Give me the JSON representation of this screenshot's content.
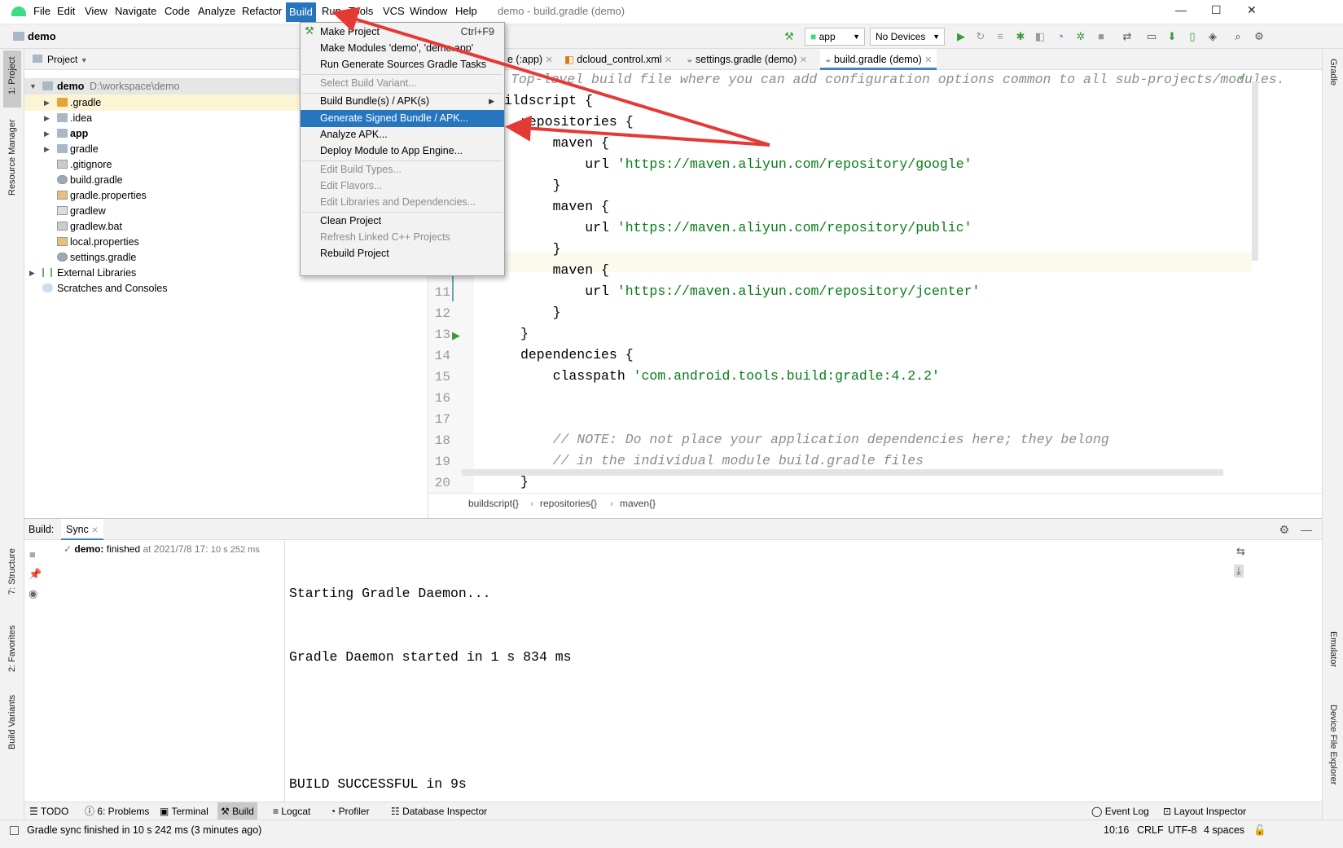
{
  "window": {
    "title": "demo - build.gradle (demo)"
  },
  "menubar": [
    "File",
    "Edit",
    "View",
    "Navigate",
    "Code",
    "Analyze",
    "Refactor",
    "Build",
    "Run",
    "Tools",
    "VCS",
    "Window",
    "Help"
  ],
  "navbar": {
    "project": "demo",
    "run_config": "app",
    "device": "No Devices"
  },
  "project_panel": {
    "view_label": "Project",
    "root": {
      "name": "demo",
      "path": "D:\\workspace\\demo"
    },
    "items": [
      ".gradle",
      ".idea",
      "app",
      "gradle",
      ".gitignore",
      "build.gradle",
      "gradle.properties",
      "gradlew",
      "gradlew.bat",
      "local.properties",
      "settings.gradle",
      "External Libraries",
      "Scratches and Consoles"
    ]
  },
  "editor": {
    "tabs": [
      "e (:app)",
      "dcloud_control.xml",
      "settings.gradle (demo)",
      "build.gradle (demo)"
    ],
    "lines": [
      {
        "n": "",
        "segments": [
          {
            "t": "Top-level build file where you can add configuration options common to all sub-projects/modules.",
            "c": "cmt"
          }
        ]
      },
      {
        "n": "",
        "segments": [
          {
            "t": "ildscript {",
            "c": ""
          }
        ]
      },
      {
        "n": "",
        "segments": [
          {
            "t": "repositories {",
            "c": ""
          }
        ]
      },
      {
        "n": "",
        "segments": [
          {
            "t": "    maven {",
            "c": ""
          }
        ]
      },
      {
        "n": "",
        "segments": [
          {
            "t": "        url ",
            "c": ""
          },
          {
            "t": "'https://maven.aliyun.com/repository/google'",
            "c": "str"
          }
        ]
      },
      {
        "n": "",
        "segments": [
          {
            "t": "    }",
            "c": ""
          }
        ]
      },
      {
        "n": "",
        "segments": [
          {
            "t": "    maven {",
            "c": ""
          }
        ]
      },
      {
        "n": "",
        "segments": [
          {
            "t": "        url ",
            "c": ""
          },
          {
            "t": "'https://maven.aliyun.com/repository/public'",
            "c": "str"
          }
        ]
      },
      {
        "n": "",
        "segments": [
          {
            "t": "    }",
            "c": ""
          }
        ]
      },
      {
        "n": "",
        "segments": [
          {
            "t": "    maven {",
            "c": ""
          }
        ]
      },
      {
        "n": "11",
        "segments": [
          {
            "t": "        url ",
            "c": ""
          },
          {
            "t": "'https://maven.aliyun.com/repository/jcenter'",
            "c": "str"
          }
        ]
      },
      {
        "n": "12",
        "segments": [
          {
            "t": "    }",
            "c": ""
          }
        ]
      },
      {
        "n": "13",
        "segments": [
          {
            "t": "}",
            "c": ""
          }
        ]
      },
      {
        "n": "14",
        "segments": [
          {
            "t": "dependencies {",
            "c": ""
          }
        ]
      },
      {
        "n": "15",
        "segments": [
          {
            "t": "    classpath ",
            "c": ""
          },
          {
            "t": "'com.android.tools.build:gradle:4.2.2'",
            "c": "str"
          }
        ]
      },
      {
        "n": "16",
        "segments": [
          {
            "t": "",
            "c": ""
          }
        ]
      },
      {
        "n": "17",
        "segments": [
          {
            "t": "",
            "c": ""
          }
        ]
      },
      {
        "n": "18",
        "segments": [
          {
            "t": "    // NOTE: Do not place your application dependencies here; they belong",
            "c": "cmt"
          }
        ]
      },
      {
        "n": "19",
        "segments": [
          {
            "t": "    // in the individual module build.gradle files",
            "c": "cmt"
          }
        ]
      },
      {
        "n": "20",
        "segments": [
          {
            "t": "}",
            "c": ""
          }
        ]
      }
    ],
    "breadcrumb": [
      "buildscript{}",
      "repositories{}",
      "maven{}"
    ]
  },
  "build_menu": {
    "items": [
      {
        "label": "Make Project",
        "shortcut": "Ctrl+F9",
        "disabled": false
      },
      {
        "label": "Make Modules 'demo', 'demo.app'",
        "shortcut": "",
        "disabled": false
      },
      {
        "label": "Run Generate Sources Gradle Tasks",
        "shortcut": "",
        "disabled": false
      },
      {
        "label": "Select Build Variant...",
        "shortcut": "",
        "disabled": true
      },
      {
        "label": "Build Bundle(s) / APK(s)",
        "shortcut": "",
        "disabled": false
      },
      {
        "label": "Generate Signed Bundle / APK...",
        "shortcut": "",
        "disabled": false
      },
      {
        "label": "Analyze APK...",
        "shortcut": "",
        "disabled": false
      },
      {
        "label": "Deploy Module to App Engine...",
        "shortcut": "",
        "disabled": false
      },
      {
        "label": "Edit Build Types...",
        "shortcut": "",
        "disabled": true
      },
      {
        "label": "Edit Flavors...",
        "shortcut": "",
        "disabled": true
      },
      {
        "label": "Edit Libraries and Dependencies...",
        "shortcut": "",
        "disabled": true
      },
      {
        "label": "Clean Project",
        "shortcut": "",
        "disabled": false
      },
      {
        "label": "Refresh Linked C++ Projects",
        "shortcut": "",
        "disabled": true
      },
      {
        "label": "Rebuild Project",
        "shortcut": "",
        "disabled": false
      }
    ]
  },
  "build_panel": {
    "title": "Build:",
    "tab": "Sync",
    "task_name": "demo:",
    "task_status": "finished",
    "task_time": "at 2021/7/8 17:",
    "task_duration": "10 s 252 ms",
    "console": [
      "Starting Gradle Daemon...",
      "Gradle Daemon started in 1 s 834 ms",
      "",
      "BUILD SUCCESSFUL in 9s"
    ]
  },
  "tool_windows": [
    "TODO",
    "6: Problems",
    "Terminal",
    "Build",
    "Logcat",
    "Profiler",
    "Database Inspector",
    "Event Log",
    "Layout Inspector"
  ],
  "side_tabs": {
    "left": [
      "1: Project",
      "Resource Manager",
      "7: Structure",
      "2: Favorites",
      "Build Variants"
    ],
    "right": [
      "Gradle",
      "Emulator",
      "Device File Explorer"
    ]
  },
  "status": {
    "message": "Gradle sync finished in 10 s 242 ms (3 minutes ago)",
    "position": "10:16",
    "line_sep": "CRLF",
    "encoding": "UTF-8",
    "indent": "4 spaces"
  },
  "colors": {
    "accent": "#2675bf",
    "arrow": "#e53935",
    "string": "#067d17",
    "comment": "#8c8c8c"
  }
}
